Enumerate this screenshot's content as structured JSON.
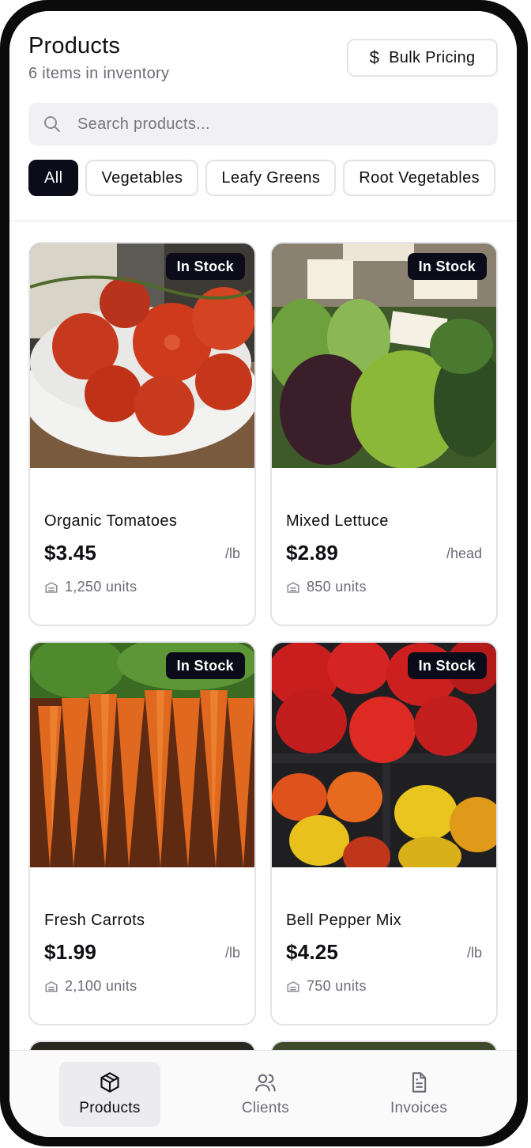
{
  "header": {
    "title": "Products",
    "subtitle": "6 items in inventory",
    "bulk_pricing_label": "Bulk Pricing"
  },
  "search": {
    "placeholder": "Search products..."
  },
  "filters": [
    {
      "label": "All",
      "active": true
    },
    {
      "label": "Vegetables",
      "active": false
    },
    {
      "label": "Leafy Greens",
      "active": false
    },
    {
      "label": "Root Vegetables",
      "active": false
    }
  ],
  "products": [
    {
      "name": "Organic Tomatoes",
      "price": "$3.45",
      "unit": "/lb",
      "stock": "1,250 units",
      "badge": "In Stock",
      "image": "tomatoes"
    },
    {
      "name": "Mixed Lettuce",
      "price": "$2.89",
      "unit": "/head",
      "stock": "850 units",
      "badge": "In Stock",
      "image": "lettuce"
    },
    {
      "name": "Fresh Carrots",
      "price": "$1.99",
      "unit": "/lb",
      "stock": "2,100 units",
      "badge": "In Stock",
      "image": "carrots"
    },
    {
      "name": "Bell Pepper Mix",
      "price": "$4.25",
      "unit": "/lb",
      "stock": "750 units",
      "badge": "In Stock",
      "image": "peppers"
    }
  ],
  "bottom_nav": [
    {
      "label": "Products",
      "icon": "box-icon",
      "active": true
    },
    {
      "label": "Clients",
      "icon": "users-icon",
      "active": false
    },
    {
      "label": "Invoices",
      "icon": "document-icon",
      "active": false
    }
  ],
  "colors": {
    "primary": "#0b0b1a",
    "muted_text": "#6b6b78",
    "border": "#e3e3e8",
    "search_bg": "#f1f1f4"
  }
}
